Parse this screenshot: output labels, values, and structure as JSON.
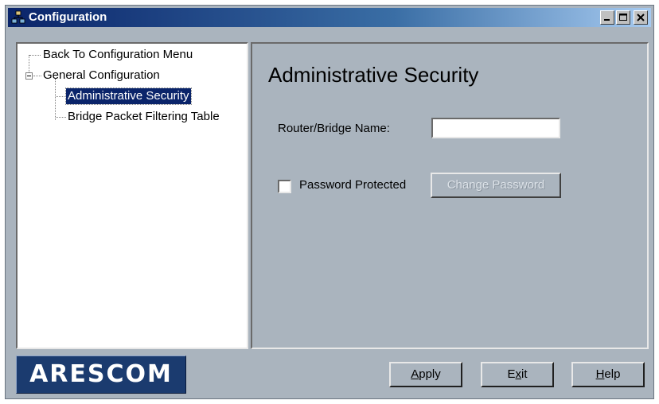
{
  "window": {
    "title": "Configuration"
  },
  "tree": {
    "items": [
      {
        "label": "Back To Configuration Menu"
      },
      {
        "label": "General Configuration"
      },
      {
        "label": "Administrative Security"
      },
      {
        "label": "Bridge Packet Filtering Table"
      }
    ]
  },
  "content": {
    "title": "Administrative Security",
    "router_name_label": "Router/Bridge Name:",
    "router_name_value": "",
    "password_protected_label": "Password Protected",
    "password_protected_checked": false,
    "change_password_label": "Change Password"
  },
  "footer": {
    "logo_text": "ARESCOM",
    "apply": {
      "pre": "",
      "mnemonic": "A",
      "post": "pply"
    },
    "exit": {
      "pre": "E",
      "mnemonic": "x",
      "post": "it"
    },
    "help": {
      "pre": "",
      "mnemonic": "H",
      "post": "elp"
    }
  },
  "colors": {
    "panel_bg": "#aab4be",
    "titlebar_start": "#0a246a",
    "selection": "#0a246a",
    "logo_bg": "#1b3b6f"
  },
  "icons": [
    "network-icon",
    "minimize-icon",
    "maximize-icon",
    "close-icon",
    "collapse-icon"
  ]
}
